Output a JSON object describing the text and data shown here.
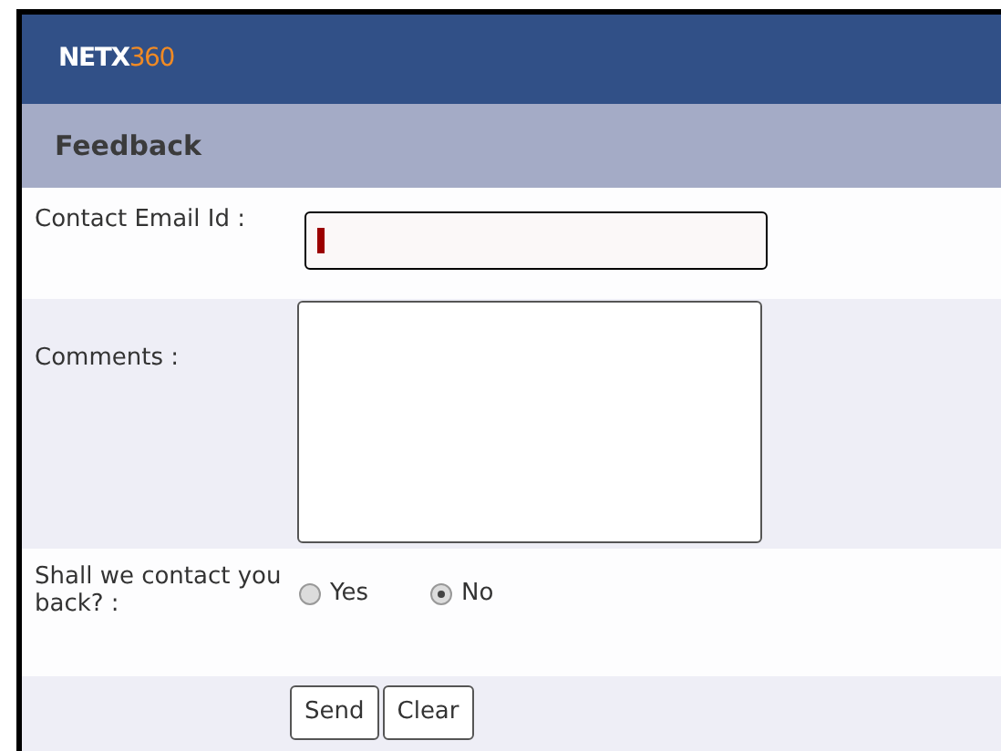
{
  "header": {
    "logo": {
      "part_1": "NETX",
      "part_2": "360"
    }
  },
  "title": "Feedback",
  "email": {
    "label": "Contact Email Id :",
    "focused": true
  },
  "comments": {
    "label": "Comments :"
  },
  "contact_back": {
    "label": "Shall we contact you back? :",
    "options": [
      {
        "label": "Yes",
        "selected": false
      },
      {
        "label": "No",
        "selected": true
      }
    ]
  },
  "buttons": [
    "Send",
    "Clear"
  ]
}
